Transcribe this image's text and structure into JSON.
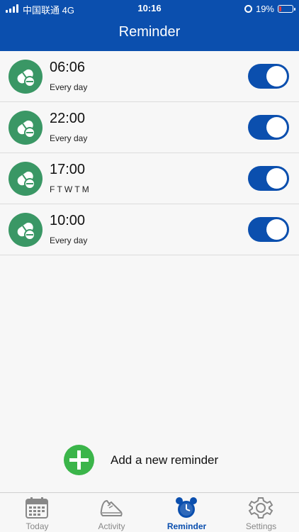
{
  "status_bar": {
    "carrier": "中国联通 4G",
    "time": "10:16",
    "battery": "19%",
    "battery_level": 0.19
  },
  "header": {
    "title": "Reminder"
  },
  "reminders": [
    {
      "time": "06:06",
      "repeat": "Every day",
      "enabled": true
    },
    {
      "time": "22:00",
      "repeat": "Every day",
      "enabled": true
    },
    {
      "time": "17:00",
      "repeat": "F T W T M",
      "enabled": true
    },
    {
      "time": "10:00",
      "repeat": "Every day",
      "enabled": true
    }
  ],
  "add_reminder": {
    "label": "Add a new reminder"
  },
  "tabs": [
    {
      "label": "Today",
      "icon": "calendar-icon",
      "active": false
    },
    {
      "label": "Activity",
      "icon": "shoe-icon",
      "active": false
    },
    {
      "label": "Reminder",
      "icon": "alarm-clock-icon",
      "active": true
    },
    {
      "label": "Settings",
      "icon": "gear-icon",
      "active": false
    }
  ],
  "colors": {
    "brand": "#0b4fae",
    "pill_circle": "#3a9765",
    "add_green": "#3bb54a",
    "tab_inactive": "#888888"
  }
}
